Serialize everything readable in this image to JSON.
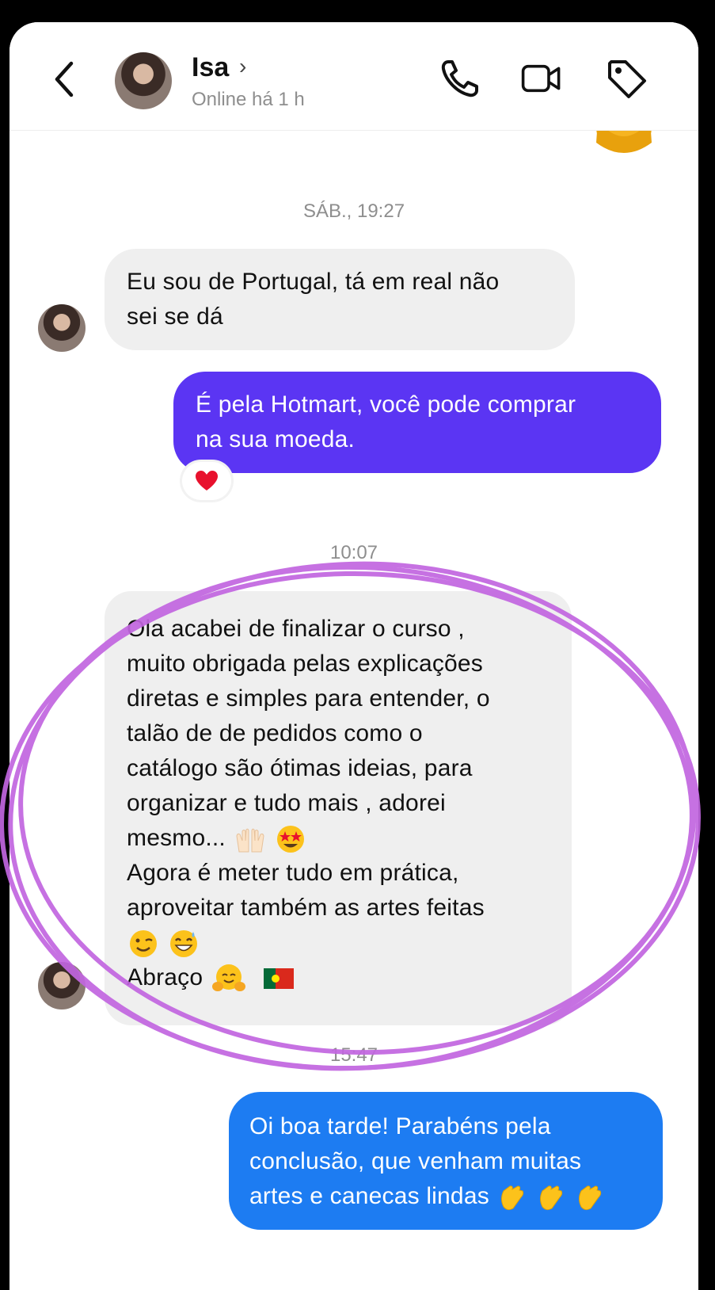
{
  "header": {
    "contact_name": "Isa",
    "chevron": "›",
    "status": "Online há 1 h",
    "icons": [
      "back-chevron-icon",
      "phone-icon",
      "video-camera-icon",
      "tag-icon"
    ]
  },
  "timestamps": {
    "first": "SÁB., 19:27",
    "second": "10:07",
    "third": "15:47"
  },
  "messages": [
    {
      "direction": "incoming",
      "lines": [
        "Eu sou de Portugal, tá em real não",
        "sei se dá"
      ]
    },
    {
      "direction": "outgoing",
      "color": "#5b35f3",
      "lines": [
        "É pela Hotmart, você pode comprar",
        "na sua moeda."
      ],
      "reaction": "red-heart-icon"
    },
    {
      "direction": "incoming",
      "lines": [
        "Ola acabei de finalizar o curso ,",
        "muito obrigada pelas explicações",
        "diretas e simples para entender, o",
        "talão de de pedidos como o",
        "catálogo são ótimas ideias, para",
        "organizar e tudo mais , adorei",
        "mesmo...",
        "Agora é meter tudo em prática,",
        "aproveitar também as artes feitas",
        "",
        " Abraço"
      ],
      "emojis": [
        "raising-hands-icon",
        "star-struck-face-icon",
        "winking-face-icon",
        "grinning-sweat-face-icon",
        "hugging-face-icon",
        "portugal-flag-icon"
      ]
    },
    {
      "direction": "outgoing",
      "color": "#1d7cf2",
      "lines": [
        "Oi boa tarde! Parabéns pela",
        "conclusão, que venham muitas",
        "artes e canecas lindas"
      ],
      "emojis": [
        "clapping-hands-icon",
        "clapping-hands-icon",
        "clapping-hands-icon"
      ]
    }
  ],
  "colors": {
    "incoming_bubble": "#efefef",
    "highlight_circle": "#c266e0"
  }
}
